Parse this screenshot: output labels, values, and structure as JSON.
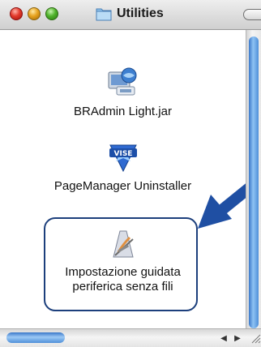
{
  "window": {
    "title": "Utilities",
    "buttons": [
      "close-button",
      "minimize-button",
      "zoom-button"
    ]
  },
  "items": [
    {
      "label": "BRAdmin Light.jar",
      "icon": "java-app-icon"
    },
    {
      "label": "PageManager Uninstaller",
      "icon": "visioneer-uninstaller-icon"
    },
    {
      "label_line1": "Impostazione guidata",
      "label_line2": "periferica senza fili",
      "icon": "wireless-setup-app-icon",
      "highlighted": true
    }
  ],
  "colors": {
    "highlight_border": "#1c3f7c",
    "arrow": "#1f4fa3",
    "scroll_thumb": "#4e8fd9"
  }
}
